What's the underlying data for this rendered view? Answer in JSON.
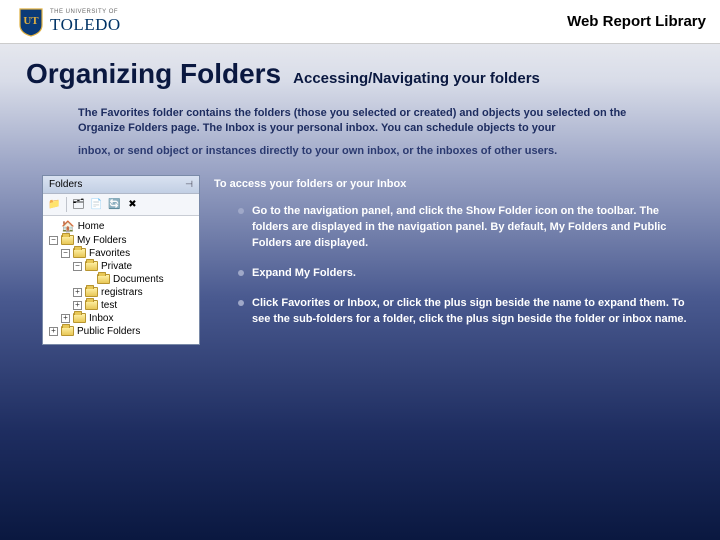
{
  "header": {
    "logo_the": "THE UNIVERSITY OF",
    "logo_name": "TOLEDO",
    "right": "Web Report  Library"
  },
  "title": {
    "main": "Organizing Folders",
    "sub": "Accessing/Navigating your folders"
  },
  "intro": {
    "p1": "The Favorites folder contains the folders (those you selected or created) and objects you selected on the Organize Folders page. The Inbox is your personal inbox. You can schedule objects to your",
    "p2": "inbox, or send object or instances directly to your own inbox, or the inboxes of other users."
  },
  "panel": {
    "title": "Folders",
    "tree": {
      "home": "Home",
      "myfolders": "My Folders",
      "favorites": "Favorites",
      "private": "Private",
      "documents": "Documents",
      "registrars": "registrars",
      "test": "test",
      "inbox": "Inbox",
      "public": "Public Folders"
    }
  },
  "instructions": {
    "heading": "To access your folders or your Inbox",
    "b1": "Go to the navigation panel, and click the Show Folder icon on the toolbar.  The folders are displayed in the navigation panel. By default, My Folders and Public Folders are displayed.",
    "b2": "Expand My Folders.",
    "b3": "Click Favorites or Inbox, or click the plus sign beside the name to expand them.  To see the sub-folders for a folder, click the plus sign beside the folder or inbox name."
  }
}
